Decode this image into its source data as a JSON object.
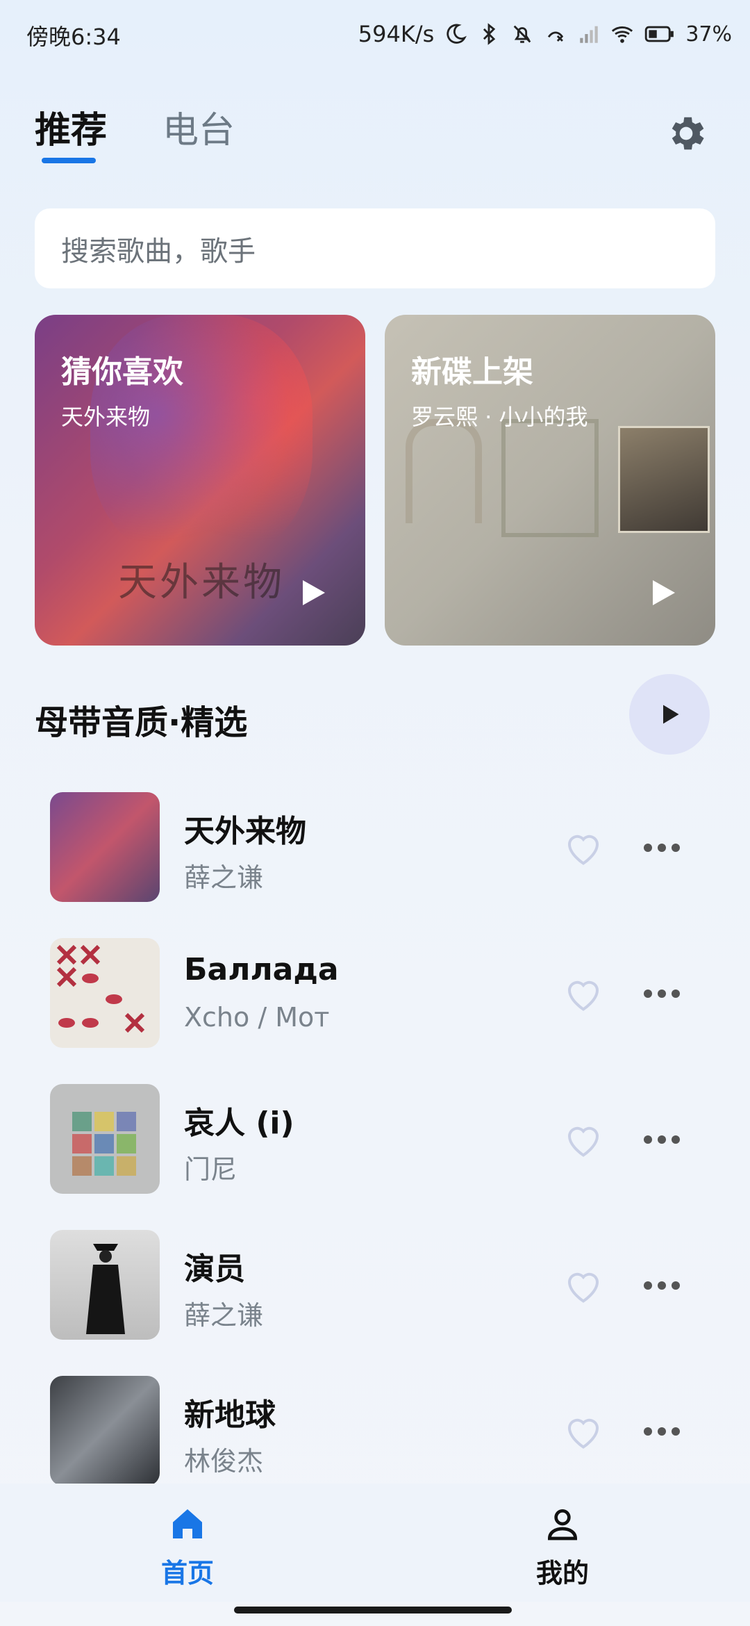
{
  "status_bar": {
    "time": "傍晚6:34",
    "network_speed": "594K/s",
    "battery_percent": "37%",
    "icons": [
      "moon-icon",
      "bluetooth-icon",
      "bell-muted-icon",
      "call-missed-icon",
      "signal-icon",
      "wifi-icon",
      "battery-icon"
    ]
  },
  "top_tabs": {
    "items": [
      {
        "label": "推荐",
        "active": true
      },
      {
        "label": "电台",
        "active": false
      }
    ],
    "settings_icon": "gear-icon"
  },
  "search": {
    "placeholder": "搜索歌曲，歌手"
  },
  "feature_cards": [
    {
      "title": "猜你喜欢",
      "subtitle": "天外来物",
      "art_text": "天外来物",
      "play_icon": "play-icon"
    },
    {
      "title": "新碟上架",
      "subtitle": "罗云熙 · 小小的我",
      "play_icon": "play-icon"
    }
  ],
  "section": {
    "title": "母带音质·精选",
    "play_all_icon": "play-icon"
  },
  "songs": [
    {
      "title": "天外来物",
      "artist": "薛之谦"
    },
    {
      "title": "Баллада",
      "artist": "Xcho / Мот"
    },
    {
      "title": "哀人 (i)",
      "artist": "门尼"
    },
    {
      "title": "演员",
      "artist": "薛之谦"
    },
    {
      "title": "新地球",
      "artist": "林俊杰"
    }
  ],
  "bottom_nav": {
    "items": [
      {
        "label": "首页",
        "icon": "home-icon",
        "active": true
      },
      {
        "label": "我的",
        "icon": "person-icon",
        "active": false
      }
    ]
  },
  "colors": {
    "accent": "#1976e6",
    "play_all_bg": "#dfe3f7",
    "muted_text": "#7a838c"
  }
}
